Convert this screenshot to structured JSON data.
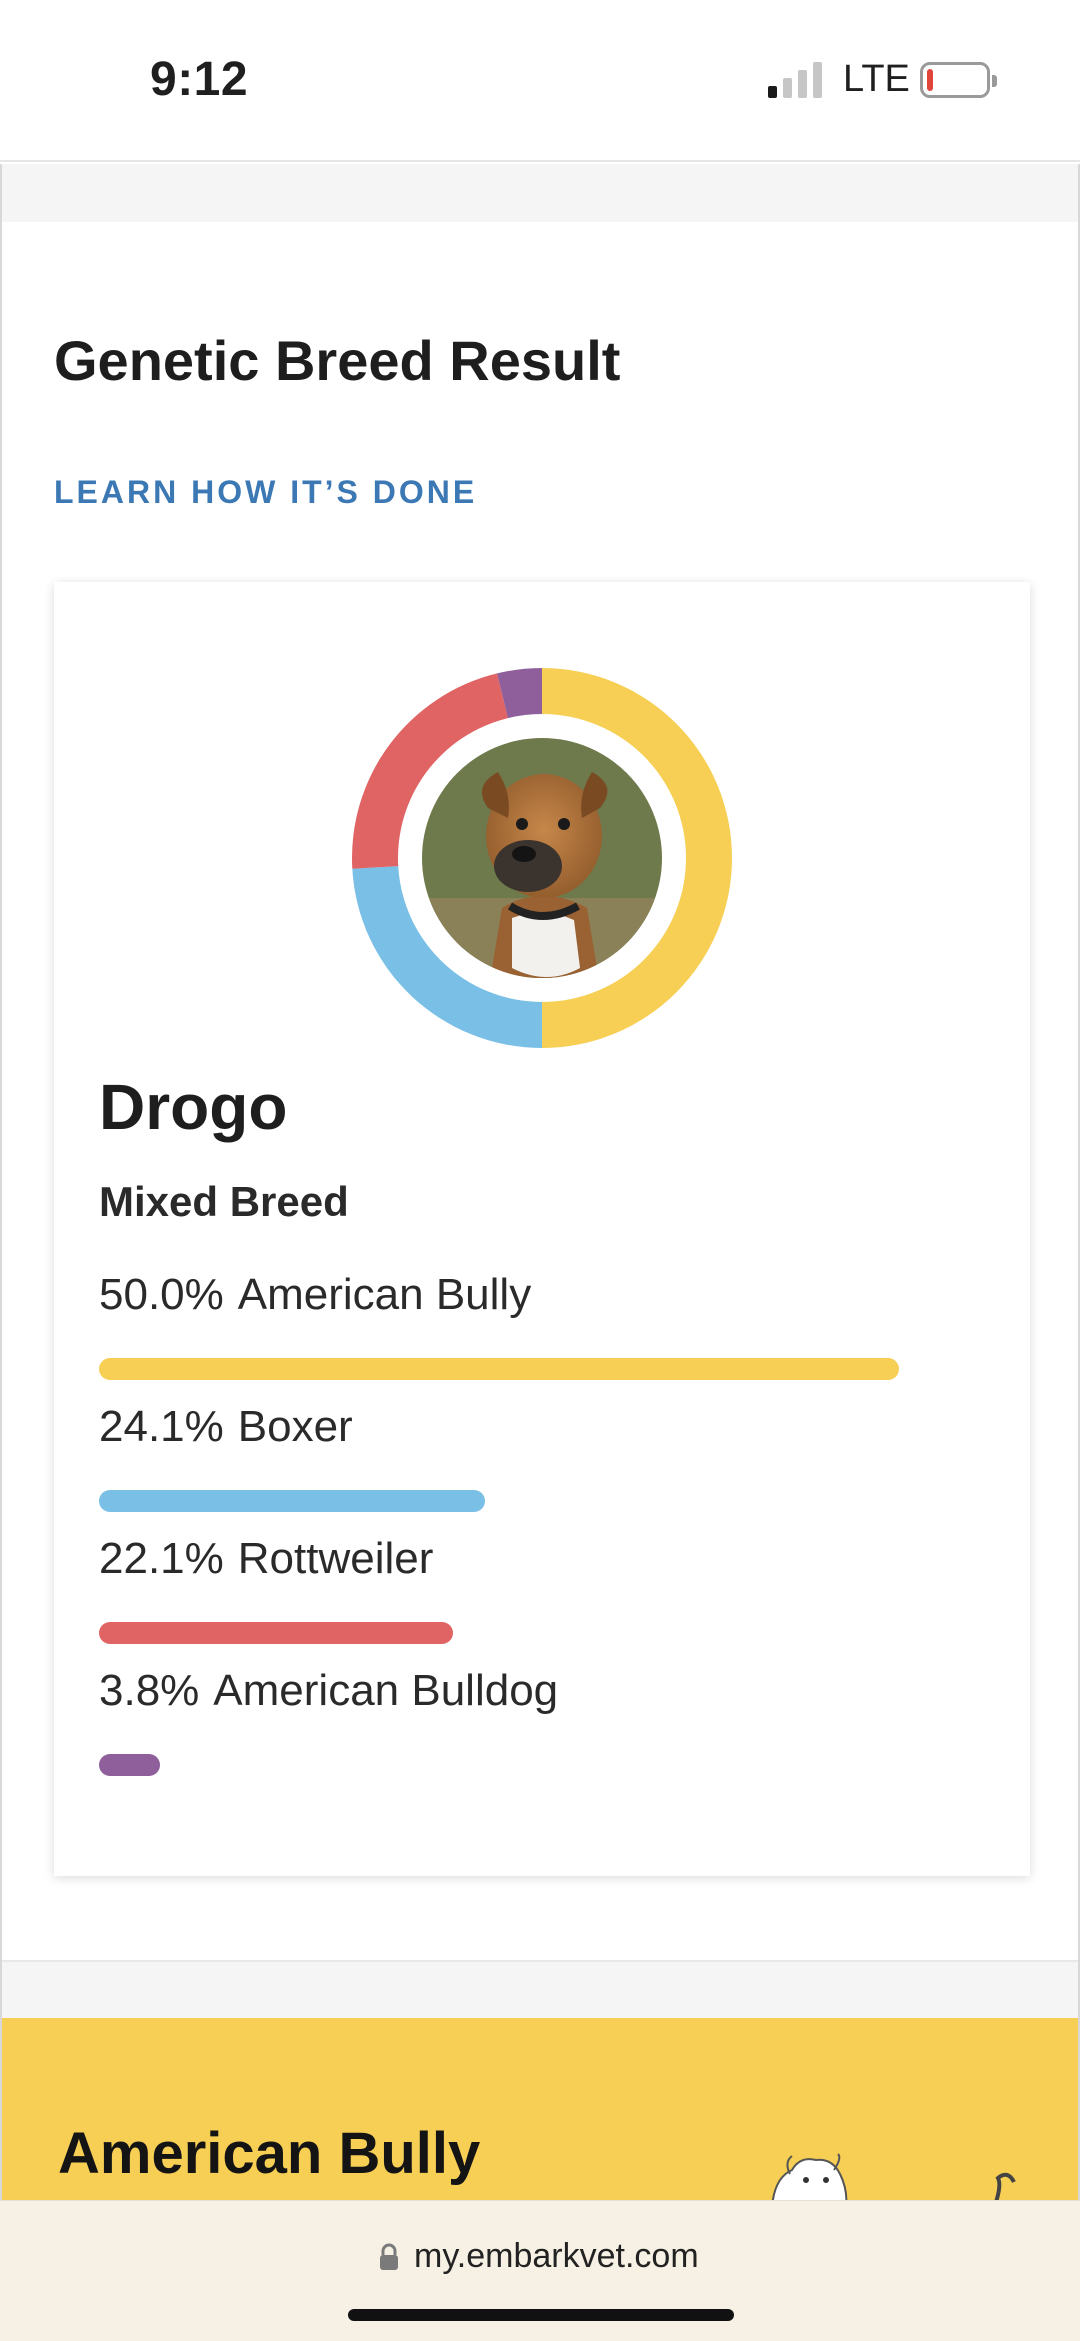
{
  "status_bar": {
    "time": "9:12",
    "network": "LTE",
    "battery_level": 0.1
  },
  "section": {
    "title": "Genetic Breed Result",
    "learn_link": "LEARN HOW IT’S DONE"
  },
  "result": {
    "dog_name": "Drogo",
    "breed_type": "Mixed Breed",
    "photo_icon": "dog-photo-icon",
    "breeds": [
      {
        "percent": "50.0%",
        "name": "American Bully",
        "value": 50.0,
        "color": "#f7cf55"
      },
      {
        "percent": "24.1%",
        "name": "Boxer",
        "value": 24.1,
        "color": "#79bfe6"
      },
      {
        "percent": "22.1%",
        "name": "Rottweiler",
        "value": 22.1,
        "color": "#e06464"
      },
      {
        "percent": "3.8%",
        "name": "American Bulldog",
        "value": 3.8,
        "color": "#8e5f9a"
      }
    ]
  },
  "next_section": {
    "title": "American Bully",
    "background": "#f7cf55"
  },
  "browser": {
    "url": "my.embarkvet.com"
  }
}
